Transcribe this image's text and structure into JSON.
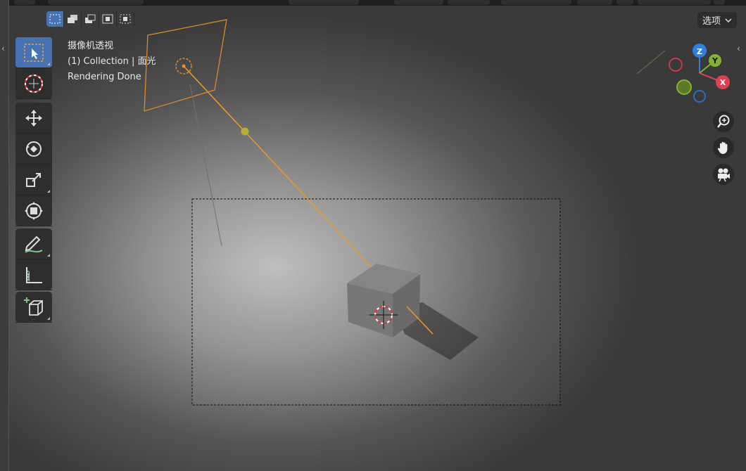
{
  "viewport": {
    "info_lines": [
      "摄像机透视",
      "(1) Collection | 面光",
      "Rendering Done"
    ],
    "options_label": "选项",
    "options_chevron": "chevron-down-icon",
    "gizmo_axes": {
      "x": "X",
      "y": "Y",
      "z": "Z"
    },
    "colors": {
      "axis_x": "#e0414e",
      "axis_y": "#84b22e",
      "axis_z": "#2e7fe0",
      "light_line": "#f0a030",
      "selection_blue": "#4772b3"
    }
  },
  "selection_modes": [
    {
      "icon": "select-new-icon",
      "active": true
    },
    {
      "icon": "select-extend-icon",
      "active": false
    },
    {
      "icon": "select-subtract-icon",
      "active": false
    },
    {
      "icon": "select-invert-icon",
      "active": false
    },
    {
      "icon": "select-intersect-icon",
      "active": false
    }
  ],
  "tools": [
    {
      "icon": "select-box-icon",
      "active": true
    },
    {
      "icon": "cursor-icon",
      "active": false
    },
    {
      "icon": "move-icon",
      "active": false
    },
    {
      "icon": "rotate-icon",
      "active": false
    },
    {
      "icon": "scale-icon",
      "active": false
    },
    {
      "icon": "transform-icon",
      "active": false
    },
    {
      "icon": "annotate-icon",
      "active": false
    },
    {
      "icon": "measure-icon",
      "active": false
    },
    {
      "icon": "add-cube-icon",
      "active": false
    }
  ],
  "nav_buttons": [
    "zoom-icon",
    "hand-pan-icon",
    "camera-view-icon"
  ]
}
